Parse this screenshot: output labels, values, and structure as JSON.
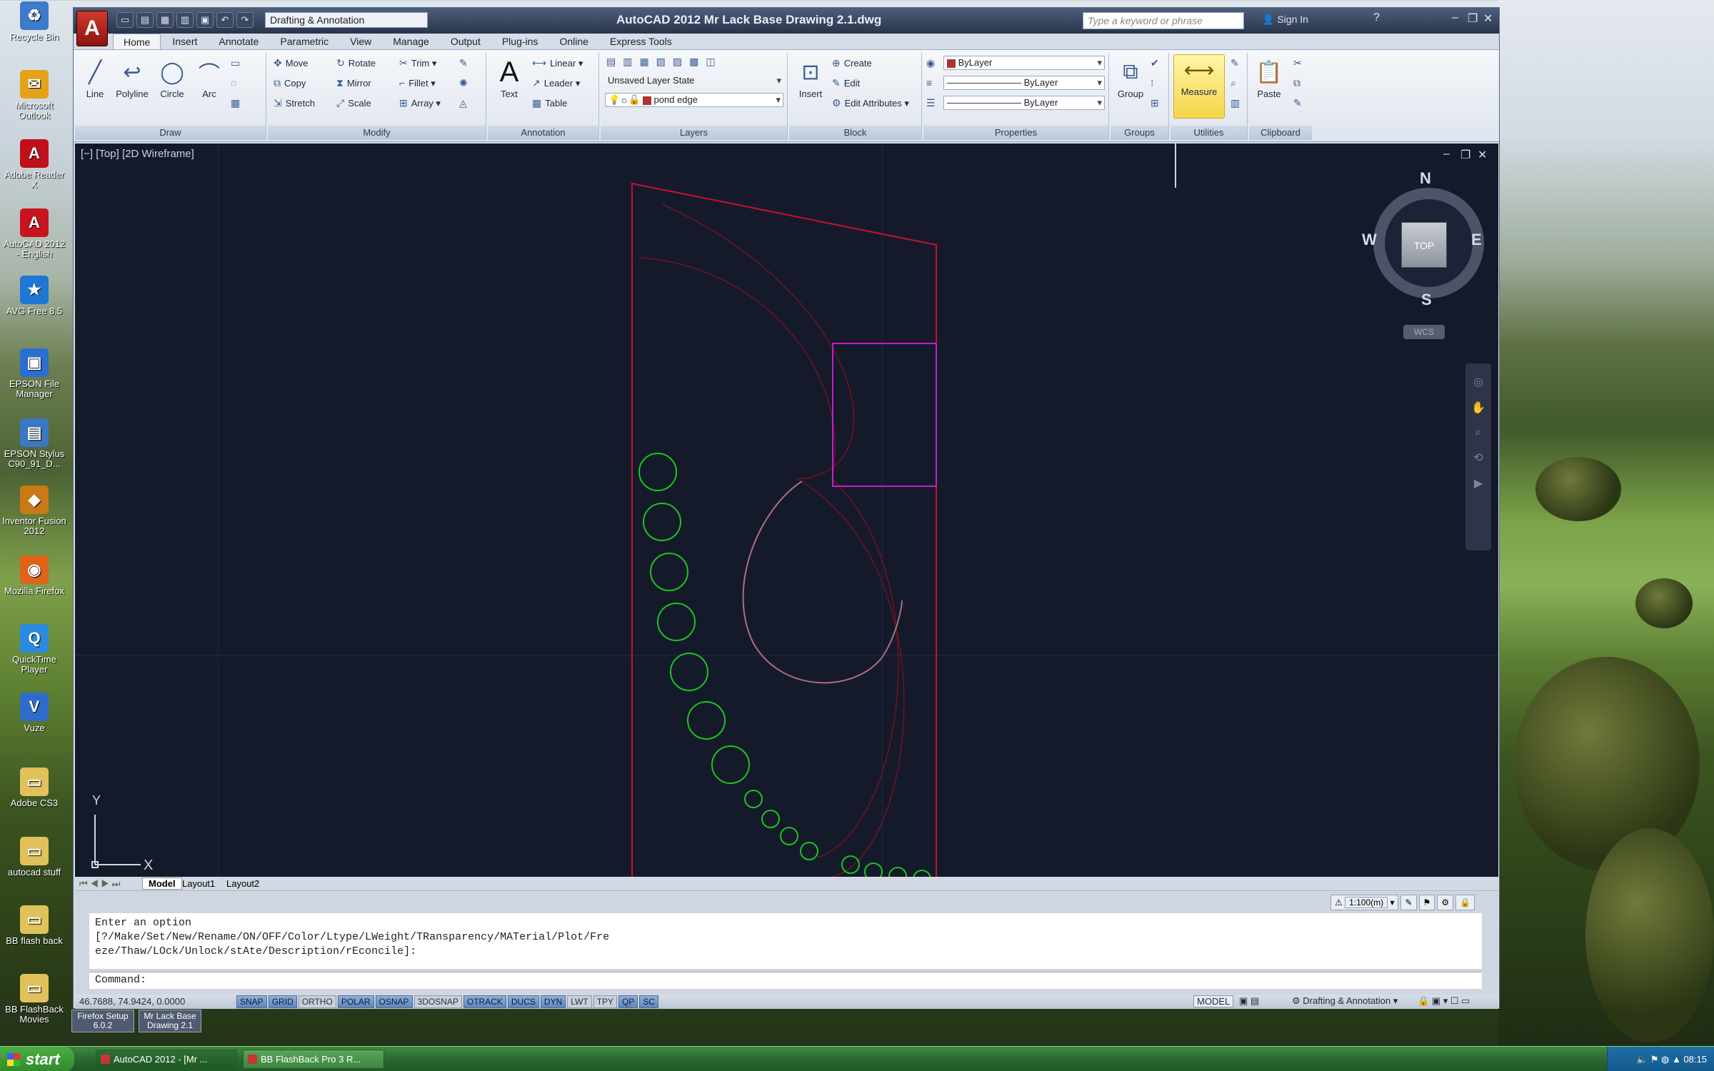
{
  "desktop": {
    "icons": [
      "Recycle Bin",
      "Microsoft Outlook",
      "Adobe Reader X",
      "AutoCAD 2012 - English",
      "AVG Free 8.5",
      "EPSON File Manager",
      "EPSON Stylus C90_91_D...",
      "Inventor Fusion 2012",
      "Mozilla Firefox",
      "QuickTime Player",
      "Vuze",
      "Adobe CS3",
      "autocad stuff",
      "BB flash back",
      "BB FlashBack Movies"
    ],
    "extra_icons": [
      "Firefox Setup 6.0.2",
      "Mr Lack Base Drawing 2.1"
    ]
  },
  "window": {
    "title": "AutoCAD 2012    Mr Lack Base Drawing 2.1.dwg",
    "workspace": "Drafting & Annotation",
    "search_placeholder": "Type a keyword or phrase",
    "sign_in": "Sign In",
    "app_button": "A"
  },
  "tabs": [
    "Home",
    "Insert",
    "Annotate",
    "Parametric",
    "View",
    "Manage",
    "Output",
    "Plug-ins",
    "Online",
    "Express Tools"
  ],
  "ribbon": {
    "draw": {
      "title": "Draw",
      "line": "Line",
      "polyline": "Polyline",
      "circle": "Circle",
      "arc": "Arc"
    },
    "modify": {
      "title": "Modify",
      "move": "Move",
      "rotate": "Rotate",
      "trim": "Trim",
      "copy": "Copy",
      "mirror": "Mirror",
      "fillet": "Fillet",
      "stretch": "Stretch",
      "scale": "Scale",
      "array": "Array"
    },
    "annotation": {
      "title": "Annotation",
      "text": "Text",
      "linear": "Linear",
      "leader": "Leader",
      "table": "Table"
    },
    "layers": {
      "title": "Layers",
      "layer_state": "Unsaved Layer State",
      "current_layer": "pond edge"
    },
    "block": {
      "title": "Block",
      "insert": "Insert",
      "create": "Create",
      "edit": "Edit",
      "edit_attributes": "Edit Attributes"
    },
    "properties": {
      "title": "Properties",
      "color": "ByLayer",
      "linetype": "ByLayer",
      "lineweight": "ByLayer"
    },
    "groups": {
      "title": "Groups",
      "group": "Group"
    },
    "utilities": {
      "title": "Utilities",
      "measure": "Measure"
    },
    "clipboard": {
      "title": "Clipboard",
      "paste": "Paste"
    }
  },
  "viewport": {
    "label": "[−] [Top] [2D Wireframe]",
    "viewcube": {
      "n": "N",
      "s": "S",
      "e": "E",
      "w": "W",
      "top": "TOP",
      "wcs": "WCS"
    },
    "ucs": {
      "x": "X",
      "y": "Y"
    },
    "colors": {
      "background": "#151a2b",
      "boundary": "#c8102e",
      "trees": "#19c41f",
      "shed": "#c21fc9",
      "path": "#7a1220",
      "pond": "#a8707e"
    }
  },
  "layout_tabs": [
    "Model",
    "Layout1",
    "Layout2"
  ],
  "command": {
    "history": "Enter an option\n[?/Make/Set/New/Rename/ON/OFF/Color/Ltype/LWeight/TRansparency/MATerial/Plot/Fre\neze/Thaw/LOck/Unlock/stAte/Description/rEconcile]:",
    "prompt": "Command:",
    "annotation_scale": "1:100(m)"
  },
  "status": {
    "coords": "46.7688, 74.9424, 0.0000",
    "toggles": [
      {
        "label": "SNAP",
        "on": true
      },
      {
        "label": "GRID",
        "on": true
      },
      {
        "label": "ORTHO",
        "on": false
      },
      {
        "label": "POLAR",
        "on": true
      },
      {
        "label": "OSNAP",
        "on": true
      },
      {
        "label": "3DOSNAP",
        "on": false
      },
      {
        "label": "OTRACK",
        "on": true
      },
      {
        "label": "DUCS",
        "on": true
      },
      {
        "label": "DYN",
        "on": true
      },
      {
        "label": "LWT",
        "on": false
      },
      {
        "label": "TPY",
        "on": false
      },
      {
        "label": "QP",
        "on": true
      },
      {
        "label": "SC",
        "on": true
      }
    ],
    "model": "MODEL",
    "workspace": "Drafting & Annotation"
  },
  "taskbar": {
    "start": "start",
    "tasks": [
      "AutoCAD 2012 - [Mr ...",
      "BB FlashBack Pro 3 R..."
    ],
    "time": "08:15"
  }
}
